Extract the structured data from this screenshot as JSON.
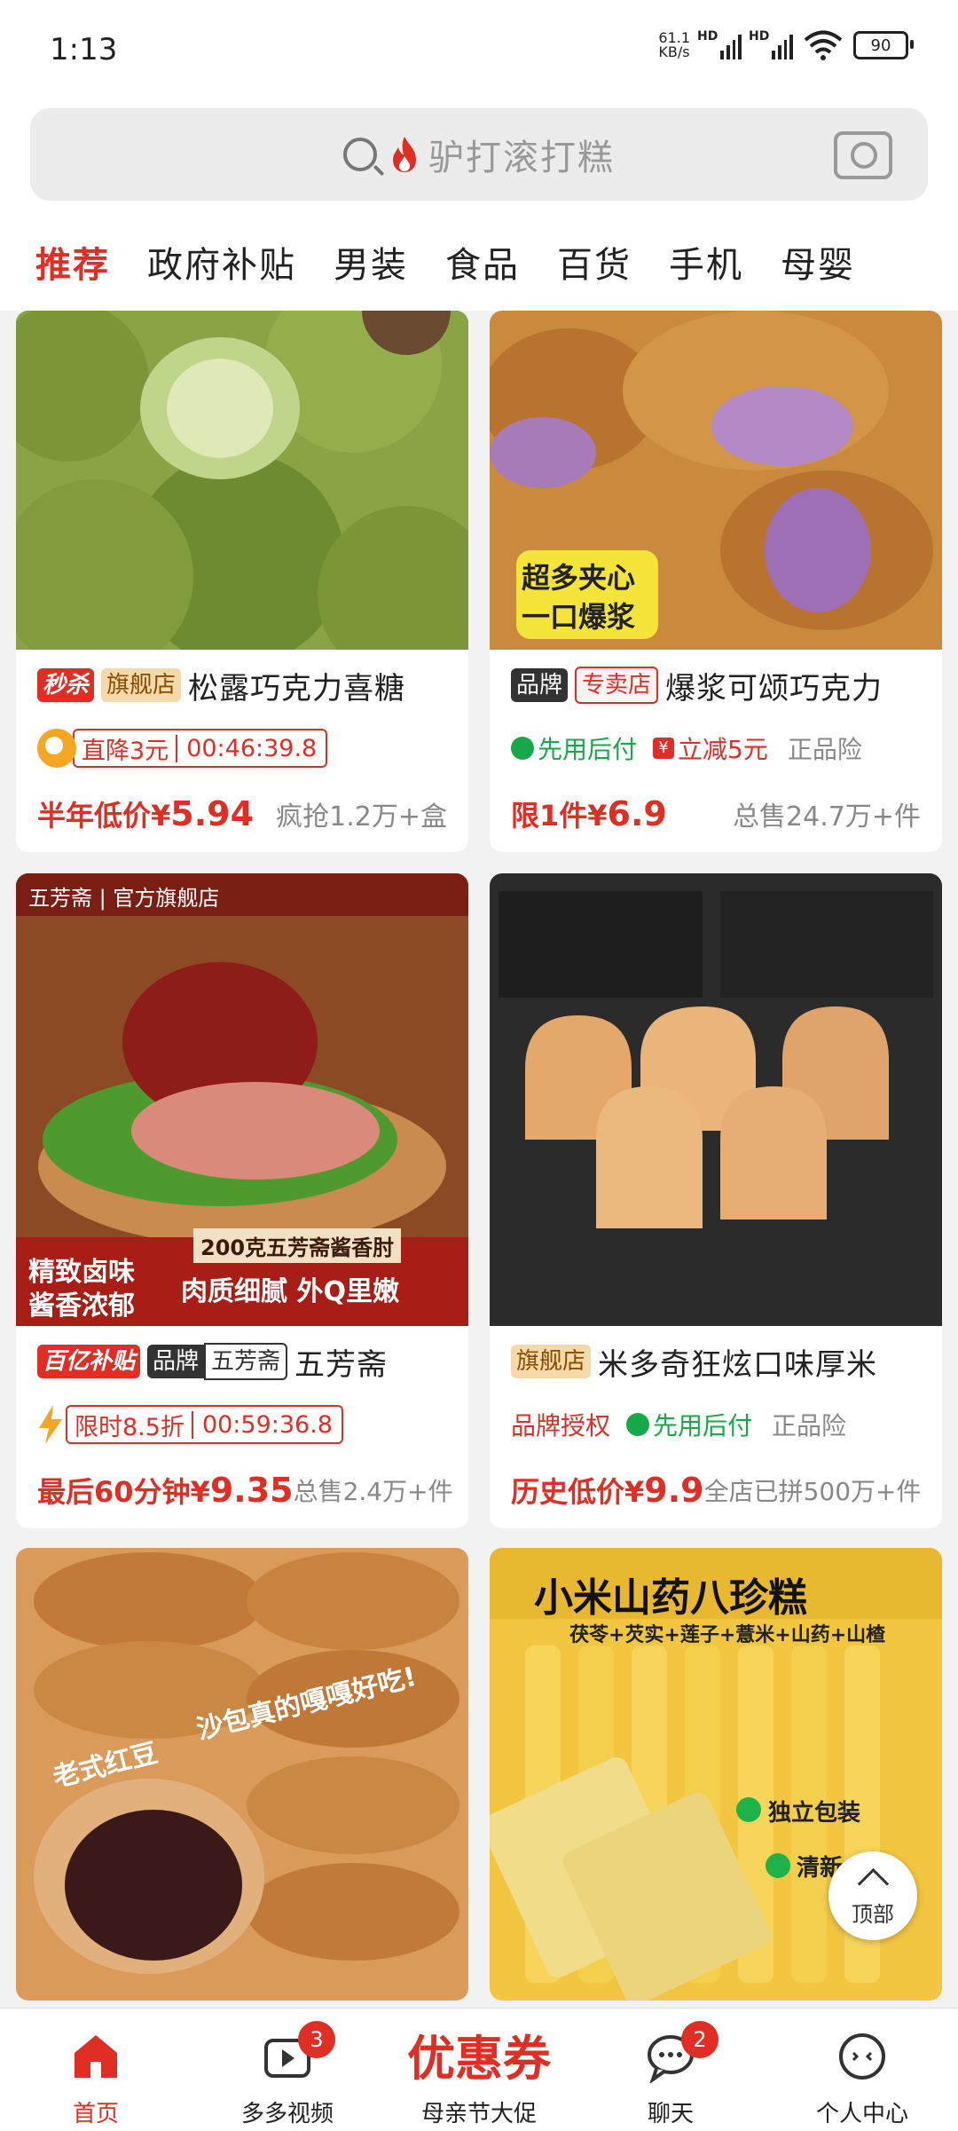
{
  "status": {
    "time": "1:13",
    "netspeed_value": "61.1",
    "netspeed_unit": "KB/s",
    "sig_label": "HD",
    "battery": "90"
  },
  "search": {
    "placeholder": "驴打滚打糕"
  },
  "tabs": [
    "推荐",
    "政府补贴",
    "男装",
    "食品",
    "百货",
    "手机",
    "母婴"
  ],
  "products": [
    {
      "badges": [
        "秒杀",
        "旗舰店"
      ],
      "title": "松露巧克力喜糖",
      "promo_label": "直降3元",
      "timer": "00:46:39.8",
      "price_label": "半年低价¥",
      "price": "5.94",
      "sold": "疯抢1.2万+盒"
    },
    {
      "badges": [
        "品牌",
        "专卖店"
      ],
      "title": "爆浆可颂巧克力",
      "tags": [
        "先用后付",
        "立减5元",
        "正品险"
      ],
      "image_text": [
        "超多夹心",
        "一口爆浆"
      ],
      "price_label": "限1件¥",
      "price": "6.9",
      "sold": "总售24.7万+件"
    },
    {
      "badges": [
        "百亿补贴",
        "品牌",
        "五芳斋"
      ],
      "title": "五芳斋",
      "promo_label": "限时8.5折",
      "timer": "00:59:36.8",
      "image_text": [
        "五芳斋",
        "官方旗舰店",
        "200克五芳斋酱香肘",
        "精致卤味",
        "酱香浓郁",
        "肉质细腻 外Q里嫩"
      ],
      "price_label": "最后60分钟¥",
      "price": "9.35",
      "sold": "总售2.4万+件"
    },
    {
      "badges": [
        "旗舰店"
      ],
      "title": "米多奇狂炫口味厚米",
      "tags": [
        "品牌授权",
        "先用后付",
        "正品险"
      ],
      "price_label": "历史低价¥",
      "price": "9.9",
      "sold": "全店已拼500万+件"
    },
    {
      "image_text": [
        "老式红豆",
        "沙包真的嘎嘎好吃!"
      ]
    },
    {
      "image_text": [
        "小米山药八珍糕",
        "茯苓+芡实+莲子+薏米+山药+山楂",
        "独立包装",
        "清新"
      ]
    }
  ],
  "scroll_top": "顶部",
  "tabbar": [
    {
      "label": "首页"
    },
    {
      "label": "多多视频",
      "badge": "3"
    },
    {
      "label": "母亲节大促",
      "banner": "优惠券"
    },
    {
      "label": "聊天",
      "badge": "2"
    },
    {
      "label": "个人中心"
    }
  ],
  "colors": {
    "accent": "#e02e24",
    "green": "#17a84a",
    "background": "#f2f2f2"
  }
}
